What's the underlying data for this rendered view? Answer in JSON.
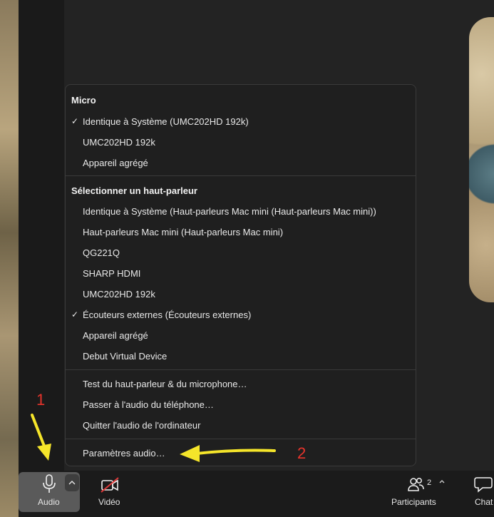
{
  "menu": {
    "micro_header": "Micro",
    "micro_items": [
      {
        "label": "Identique à Système (UMC202HD 192k)",
        "checked": true
      },
      {
        "label": "UMC202HD 192k",
        "checked": false
      },
      {
        "label": "Appareil agrégé",
        "checked": false
      }
    ],
    "speaker_header": "Sélectionner un haut-parleur",
    "speaker_items": [
      {
        "label": "Identique à Système (Haut-parleurs Mac mini (Haut-parleurs Mac mini))",
        "checked": false
      },
      {
        "label": "Haut-parleurs Mac mini (Haut-parleurs Mac mini)",
        "checked": false
      },
      {
        "label": "QG221Q",
        "checked": false
      },
      {
        "label": "SHARP HDMI",
        "checked": false
      },
      {
        "label": "UMC202HD 192k",
        "checked": false
      },
      {
        "label": "Écouteurs externes (Écouteurs externes)",
        "checked": true
      },
      {
        "label": "Appareil agrégé",
        "checked": false
      },
      {
        "label": "Debut Virtual Device",
        "checked": false
      }
    ],
    "action_items": [
      "Test du haut-parleur & du microphone…",
      "Passer à l'audio du téléphone…",
      "Quitter l'audio de l'ordinateur"
    ],
    "settings_item": "Paramètres audio…",
    "check_glyph": "✓"
  },
  "toolbar": {
    "audio_label": "Audio",
    "video_label": "Vidéo",
    "participants_label": "Participants",
    "participants_count": "2",
    "chat_label": "Chat"
  },
  "annotations": {
    "step1": "1",
    "step2": "2",
    "arrow_color": "#f5e52a",
    "number_color": "#e8342c"
  }
}
